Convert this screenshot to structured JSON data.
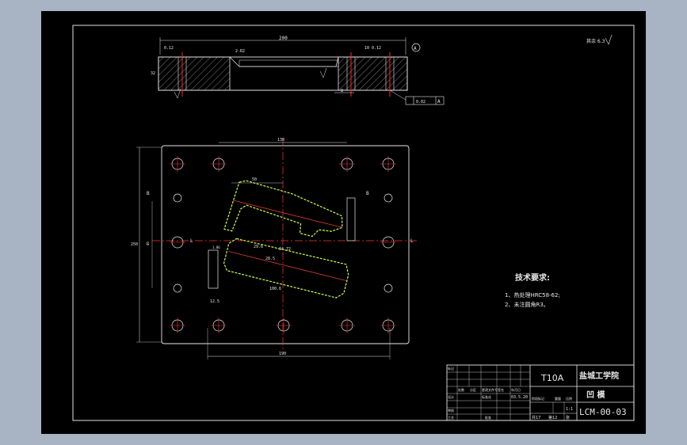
{
  "section": {
    "overall_dim": "200",
    "left_tol": "0.12",
    "right_tol": "10 0.12",
    "angle": "2-R2",
    "height_dim": "32",
    "datum": "A",
    "depth_dim": "8",
    "flatness_tol": "0.02",
    "flatness_datum": "A"
  },
  "plan": {
    "top_span": "130",
    "bottom_span": "190",
    "height_span": "250",
    "inner_span": "40",
    "offset_dim": "50",
    "slot_dim": "29.6",
    "label_a": "34.72",
    "label_b": "28.5",
    "label_c": "100.6",
    "label_d": "1.86",
    "label_e": "12.5",
    "section_mark": "B",
    "view_mark": "L"
  },
  "roughness": "其余 6.3",
  "tech": {
    "title": "技术要求:",
    "items": [
      "1、热处理HRC58-62;",
      "2、未注圆角R3。"
    ]
  },
  "title_block": {
    "material": "T10A",
    "school": "盐城工学院",
    "part_name": "凹  模",
    "drawing_no": "LCM-00-03",
    "scale": "1:1",
    "sheet_count": "共17",
    "sheet_no": "第12",
    "unit": "张",
    "small_labels": [
      "标记",
      "处数",
      "分区",
      "更改文件号",
      "签名",
      "年月日",
      "设计",
      "审核",
      "工艺",
      "批准",
      "标准化",
      "阶段标记",
      "重量",
      "比例"
    ],
    "date_code": "03.5.20"
  }
}
